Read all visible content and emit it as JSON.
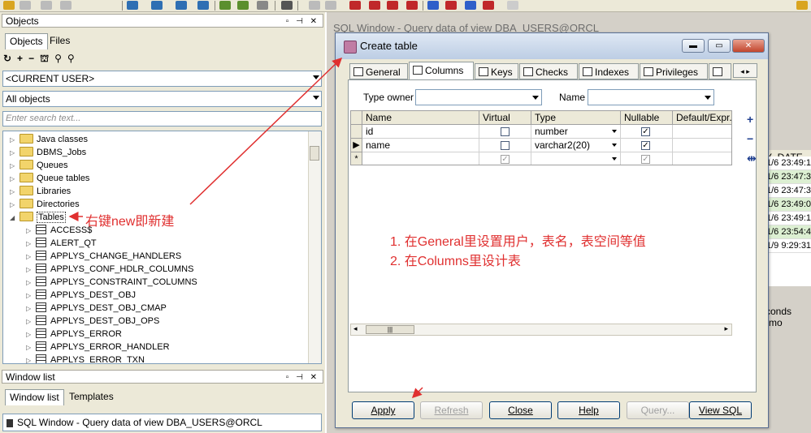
{
  "left_panel": {
    "objects_title": "Objects",
    "tabs": [
      "Objects",
      "Files"
    ],
    "user_combo": "<CURRENT USER>",
    "filter_combo": "All objects",
    "search_placeholder": "Enter search text...",
    "tree_items": [
      {
        "label": "Java classes",
        "type": "folder"
      },
      {
        "label": "DBMS_Jobs",
        "type": "folder"
      },
      {
        "label": "Queues",
        "type": "folder"
      },
      {
        "label": "Queue tables",
        "type": "folder"
      },
      {
        "label": "Libraries",
        "type": "folder"
      },
      {
        "label": "Directories",
        "type": "folder"
      },
      {
        "label": "Tables",
        "type": "folder-open"
      },
      {
        "label": "ACCESS$",
        "type": "table"
      },
      {
        "label": "ALERT_QT",
        "type": "table"
      },
      {
        "label": "APPLYS_CHANGE_HANDLERS",
        "type": "table"
      },
      {
        "label": "APPLYS_CONF_HDLR_COLUMNS",
        "type": "table"
      },
      {
        "label": "APPLYS_CONSTRAINT_COLUMNS",
        "type": "table"
      },
      {
        "label": "APPLYS_DEST_OBJ",
        "type": "table"
      },
      {
        "label": "APPLYS_DEST_OBJ_CMAP",
        "type": "table"
      },
      {
        "label": "APPLYS_DEST_OBJ_OPS",
        "type": "table"
      },
      {
        "label": "APPLYS_ERROR",
        "type": "table"
      },
      {
        "label": "APPLYS_ERROR_HANDLER",
        "type": "table"
      },
      {
        "label": "APPLYS_ERROR_TXN",
        "type": "table"
      }
    ],
    "tables_annotation": "右键new即新建",
    "window_list_title": "Window list",
    "window_list_tabs": [
      "Window list",
      "Templates"
    ],
    "window_list_item": "SQL Window - Query data of view DBA_USERS@ORCL"
  },
  "background_window": {
    "title": "SQL Window - Query data of view DBA_USERS@ORCL",
    "column_header": "Y_DATE",
    "rows": [
      "1/6 23:49:1",
      "1/6 23:47:3",
      "1/6 23:47:3",
      "1/6 23:49:0",
      "1/6 23:49:1",
      "1/6 23:54:4",
      "1/9 9:29:31"
    ],
    "status": "conds (mo"
  },
  "dialog": {
    "title": "Create table",
    "tabs": [
      "General",
      "Columns",
      "Keys",
      "Checks",
      "Indexes",
      "Privileges"
    ],
    "active_tab": "Columns",
    "type_owner_label": "Type owner",
    "name_label": "Name",
    "grid_headers": [
      "Name",
      "Virtual",
      "Type",
      "Nullable",
      "Default/Expr."
    ],
    "grid_rows": [
      {
        "name": "id",
        "virtual": false,
        "type": "number",
        "nullable": true
      },
      {
        "name": "name",
        "virtual": false,
        "type": "varchar2(20)",
        "nullable": true
      },
      {
        "name": "",
        "virtual": true,
        "type": "",
        "nullable": true
      }
    ],
    "notes": [
      "1. 在General里设置用户，表名，表空间等值",
      "2. 在Columns里设计表"
    ],
    "buttons": {
      "apply": "Apply",
      "refresh": "Refresh",
      "close": "Close",
      "help": "Help",
      "query": "Query...",
      "view_sql": "View SQL"
    }
  },
  "colors": {
    "annotation": "#e03030",
    "dialog_title_bg": "#bccde4",
    "panel_bg": "#ece9d8"
  }
}
